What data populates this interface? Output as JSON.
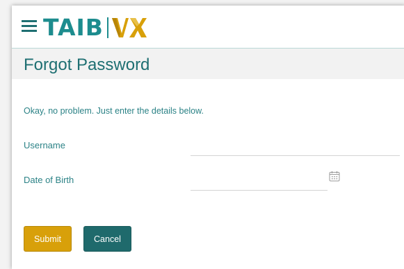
{
  "header": {
    "logo_text": "TAIB",
    "logo_mark": "VX",
    "menu_icon": "hamburger-menu-icon"
  },
  "page": {
    "title": "Forgot Password",
    "intro": "Okay, no problem. Just enter the details below."
  },
  "form": {
    "username_label": "Username",
    "username_value": "",
    "dob_label": "Date of Birth",
    "dob_value": "",
    "calendar_icon": "calendar-icon"
  },
  "buttons": {
    "submit_label": "Submit",
    "cancel_label": "Cancel"
  },
  "colors": {
    "accent_teal": "#1d8c8e",
    "dark_teal": "#1f6a6c",
    "gold": "#d8a00a",
    "title_bar_bg": "#f2f2f2"
  }
}
